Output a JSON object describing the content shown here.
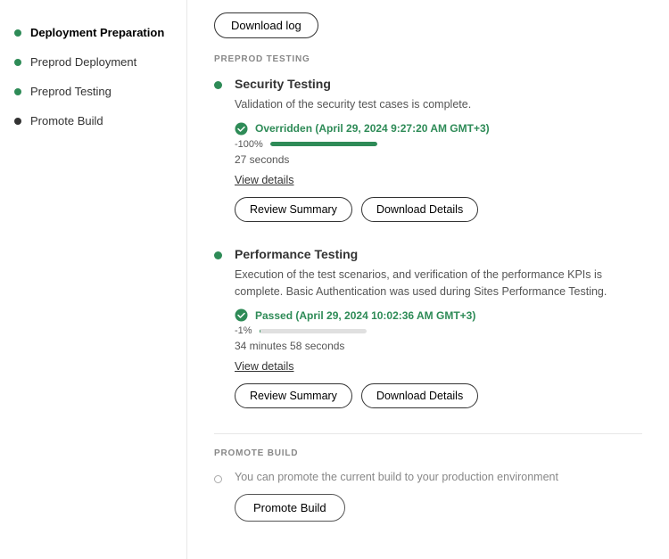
{
  "sidebar": {
    "items": [
      {
        "label": "Deployment Preparation",
        "dotClass": "dot-green",
        "active": true
      },
      {
        "label": "Preprod Deployment",
        "dotClass": "dot-green",
        "active": false
      },
      {
        "label": "Preprod Testing",
        "dotClass": "dot-green",
        "active": false
      },
      {
        "label": "Promote Build",
        "dotClass": "dot-black",
        "active": false
      }
    ]
  },
  "header": {
    "download_log": "Download log"
  },
  "preprod_testing": {
    "section_label": "PREPROD TESTING",
    "items": [
      {
        "title": "Security Testing",
        "description": "Validation of the security test cases is complete.",
        "status": "Overridden  (April 29, 2024 9:27:20 AM GMT+3)",
        "progress_pct": 100,
        "progress_label": "-100%",
        "duration": "27 seconds",
        "view_details": "View details",
        "btn1": "Review Summary",
        "btn2": "Download Details"
      },
      {
        "title": "Performance Testing",
        "description": "Execution of the test scenarios, and verification of the performance KPIs is complete. Basic Authentication was used during Sites Performance Testing.",
        "status": "Passed  (April 29, 2024 10:02:36 AM GMT+3)",
        "progress_pct": 1,
        "progress_label": "-1%",
        "duration": "34 minutes 58 seconds",
        "view_details": "View details",
        "btn1": "Review Summary",
        "btn2": "Download Details"
      }
    ]
  },
  "promote_build": {
    "section_label": "PROMOTE BUILD",
    "description": "You can promote the current build to your production environment",
    "btn_label": "Promote Build"
  }
}
